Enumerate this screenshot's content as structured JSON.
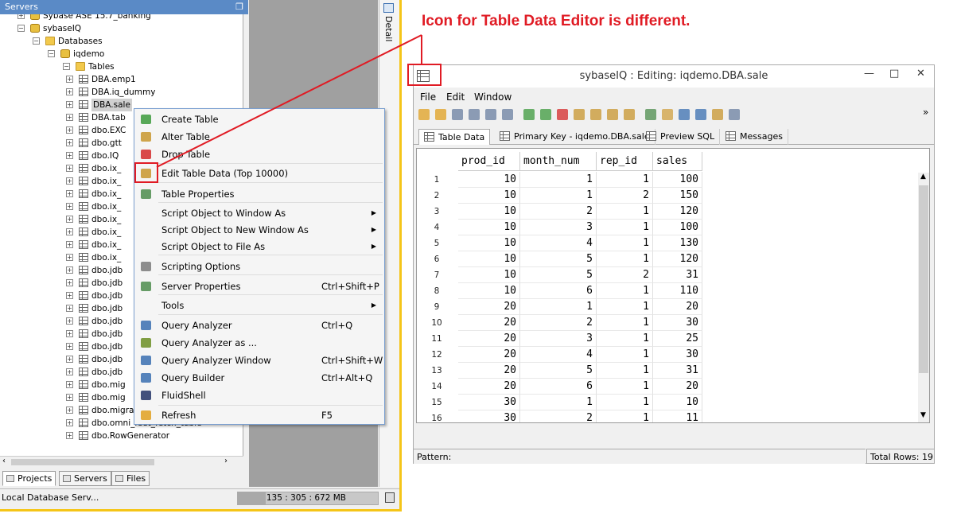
{
  "left_panel": {
    "header_title": "Servers",
    "tree": [
      {
        "label": "Sybase ASE 15.7_banking",
        "level": 1,
        "icon": "server-icon",
        "expander": "+"
      },
      {
        "label": "sybaseIQ",
        "level": 1,
        "icon": "server-icon",
        "expander": "-"
      },
      {
        "label": "Databases",
        "level": 2,
        "icon": "folder-icon",
        "expander": "-"
      },
      {
        "label": "iqdemo",
        "level": 3,
        "icon": "database-icon",
        "expander": "-"
      },
      {
        "label": "Tables",
        "level": 4,
        "icon": "folder-icon",
        "expander": "-"
      },
      {
        "label": "DBA.emp1",
        "level": 5,
        "icon": "table-icon",
        "expander": "+"
      },
      {
        "label": "DBA.iq_dummy",
        "level": 5,
        "icon": "table-icon",
        "expander": "+"
      },
      {
        "label": "DBA.sale",
        "level": 5,
        "icon": "table-icon",
        "expander": "+",
        "selected": true
      },
      {
        "label": "DBA.tab",
        "level": 5,
        "icon": "table-icon",
        "expander": "+"
      },
      {
        "label": "dbo.EXC",
        "level": 5,
        "icon": "table-icon",
        "expander": "+"
      },
      {
        "label": "dbo.gtt",
        "level": 5,
        "icon": "table-icon",
        "expander": "+"
      },
      {
        "label": "dbo.IQ",
        "level": 5,
        "icon": "table-icon",
        "expander": "+"
      },
      {
        "label": "dbo.ix_",
        "level": 5,
        "icon": "table-icon",
        "expander": "+"
      },
      {
        "label": "dbo.ix_",
        "level": 5,
        "icon": "table-icon",
        "expander": "+"
      },
      {
        "label": "dbo.ix_",
        "level": 5,
        "icon": "table-icon",
        "expander": "+"
      },
      {
        "label": "dbo.ix_",
        "level": 5,
        "icon": "table-icon",
        "expander": "+"
      },
      {
        "label": "dbo.ix_",
        "level": 5,
        "icon": "table-icon",
        "expander": "+"
      },
      {
        "label": "dbo.ix_",
        "level": 5,
        "icon": "table-icon",
        "expander": "+"
      },
      {
        "label": "dbo.ix_",
        "level": 5,
        "icon": "table-icon",
        "expander": "+"
      },
      {
        "label": "dbo.ix_",
        "level": 5,
        "icon": "table-icon",
        "expander": "+"
      },
      {
        "label": "dbo.jdb",
        "level": 5,
        "icon": "table-icon",
        "expander": "+"
      },
      {
        "label": "dbo.jdb",
        "level": 5,
        "icon": "table-icon",
        "expander": "+"
      },
      {
        "label": "dbo.jdb",
        "level": 5,
        "icon": "table-icon",
        "expander": "+"
      },
      {
        "label": "dbo.jdb",
        "level": 5,
        "icon": "table-icon",
        "expander": "+"
      },
      {
        "label": "dbo.jdb",
        "level": 5,
        "icon": "table-icon",
        "expander": "+"
      },
      {
        "label": "dbo.jdb",
        "level": 5,
        "icon": "table-icon",
        "expander": "+"
      },
      {
        "label": "dbo.jdb",
        "level": 5,
        "icon": "table-icon",
        "expander": "+"
      },
      {
        "label": "dbo.jdb",
        "level": 5,
        "icon": "table-icon",
        "expander": "+"
      },
      {
        "label": "dbo.jdb",
        "level": 5,
        "icon": "table-icon",
        "expander": "+"
      },
      {
        "label": "dbo.mig",
        "level": 5,
        "icon": "table-icon",
        "expander": "+"
      },
      {
        "label": "dbo.mig",
        "level": 5,
        "icon": "table-icon",
        "expander": "+"
      },
      {
        "label": "dbo.migrate_sql_dem",
        "level": 5,
        "icon": "table-icon",
        "expander": "+"
      },
      {
        "label": "dbo.omni_rset_fetch_table",
        "level": 5,
        "icon": "table-icon",
        "expander": "+"
      },
      {
        "label": "dbo.RowGenerator",
        "level": 5,
        "icon": "table-icon",
        "expander": "+"
      }
    ],
    "bottom_tabs": [
      {
        "label": "Projects",
        "active": true
      },
      {
        "label": "Servers",
        "active": false
      },
      {
        "label": "Files",
        "active": false
      }
    ],
    "detail_label": "Detail",
    "status_text": "Local Database Serv...",
    "memory_text": "135 : 305 : 672 MB",
    "memory_fraction": 0.2
  },
  "context_menu": {
    "items": [
      {
        "label": "Create Table",
        "shortcut": "",
        "submenu": false,
        "icon": "create-table-icon"
      },
      {
        "label": "Alter Table",
        "shortcut": "",
        "submenu": false,
        "icon": "alter-table-icon"
      },
      {
        "label": "Drop Table",
        "shortcut": "",
        "submenu": false,
        "icon": "drop-table-icon"
      },
      {
        "label": "Edit Table Data (Top 10000)",
        "shortcut": "",
        "submenu": false,
        "icon": "edit-table-data-icon"
      },
      {
        "label": "Table Properties",
        "shortcut": "",
        "submenu": false,
        "icon": "table-properties-icon"
      },
      {
        "label": "Script Object to Window As",
        "shortcut": "",
        "submenu": true,
        "icon": ""
      },
      {
        "label": "Script Object to New Window As",
        "shortcut": "",
        "submenu": true,
        "icon": ""
      },
      {
        "label": "Script Object to File As",
        "shortcut": "",
        "submenu": true,
        "icon": ""
      },
      {
        "label": "Scripting Options",
        "shortcut": "",
        "submenu": false,
        "icon": "scripting-options-icon"
      },
      {
        "label": "Server Properties",
        "shortcut": "Ctrl+Shift+P",
        "submenu": false,
        "icon": "server-properties-icon"
      },
      {
        "label": "Tools",
        "shortcut": "",
        "submenu": true,
        "icon": ""
      },
      {
        "label": "Query Analyzer",
        "shortcut": "Ctrl+Q",
        "submenu": false,
        "icon": "query-analyzer-icon"
      },
      {
        "label": "Query Analyzer as ...",
        "shortcut": "",
        "submenu": false,
        "icon": "query-analyzer-as-icon"
      },
      {
        "label": "Query Analyzer Window",
        "shortcut": "Ctrl+Shift+W",
        "submenu": false,
        "icon": "query-analyzer-window-icon"
      },
      {
        "label": "Query Builder",
        "shortcut": "Ctrl+Alt+Q",
        "submenu": false,
        "icon": "query-builder-icon"
      },
      {
        "label": "FluidShell",
        "shortcut": "",
        "submenu": false,
        "icon": "fluidshell-icon"
      },
      {
        "label": "Refresh",
        "shortcut": "F5",
        "submenu": false,
        "icon": "refresh-icon"
      }
    ]
  },
  "editor_window": {
    "title": "sybaseIQ : Editing: iqdemo.DBA.sale",
    "controls": {
      "minimize": "—",
      "maximize": "□",
      "close": "✕"
    },
    "menus": [
      "File",
      "Edit",
      "Window"
    ],
    "overflow_symbol": "»",
    "tabs": [
      {
        "label": "Table Data",
        "active": true,
        "icon": "table-data-icon"
      },
      {
        "label": "Primary Key - iqdemo.DBA.sale",
        "active": false,
        "icon": "primary-key-icon"
      },
      {
        "label": "Preview SQL",
        "active": false,
        "icon": "preview-sql-icon"
      },
      {
        "label": "Messages",
        "active": false,
        "icon": "messages-icon"
      }
    ],
    "columns": [
      "prod_id",
      "month_num",
      "rep_id",
      "sales"
    ],
    "rows": [
      [
        1,
        10,
        1,
        1,
        100
      ],
      [
        2,
        10,
        1,
        2,
        150
      ],
      [
        3,
        10,
        2,
        1,
        120
      ],
      [
        4,
        10,
        3,
        1,
        100
      ],
      [
        5,
        10,
        4,
        1,
        130
      ],
      [
        6,
        10,
        5,
        1,
        120
      ],
      [
        7,
        10,
        5,
        2,
        31
      ],
      [
        8,
        10,
        6,
        1,
        110
      ],
      [
        9,
        20,
        1,
        1,
        20
      ],
      [
        10,
        20,
        2,
        1,
        30
      ],
      [
        11,
        20,
        3,
        1,
        25
      ],
      [
        12,
        20,
        4,
        1,
        30
      ],
      [
        13,
        20,
        5,
        1,
        31
      ],
      [
        14,
        20,
        6,
        1,
        20
      ],
      [
        15,
        30,
        1,
        1,
        10
      ],
      [
        16,
        30,
        2,
        1,
        11
      ]
    ],
    "pattern_label": "Pattern:",
    "total_rows": "Total Rows: 19"
  },
  "annotation": {
    "text": "Icon for Table Data Editor is different.",
    "color": "#e01b24"
  }
}
